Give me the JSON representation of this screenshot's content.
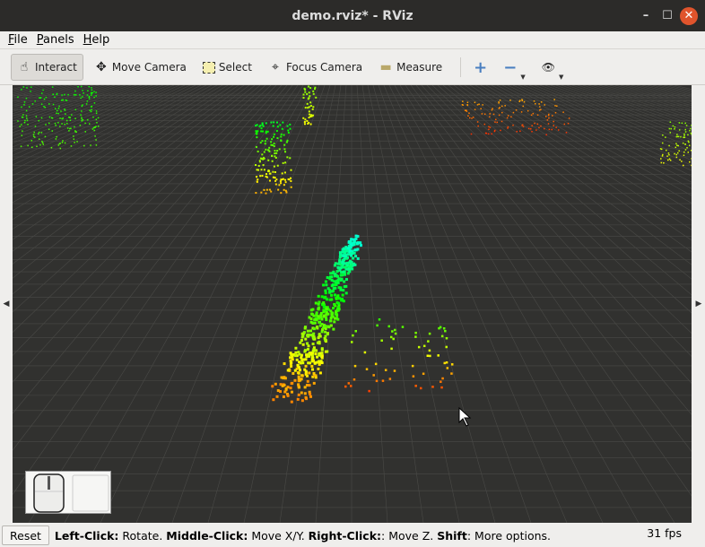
{
  "window": {
    "title": "demo.rviz* - RViz",
    "minimize": "–",
    "maximize": "☐",
    "close": "✕"
  },
  "menu": [
    {
      "label": "File",
      "key": "F",
      "rest": "ile"
    },
    {
      "label": "Panels",
      "key": "P",
      "rest": "anels"
    },
    {
      "label": "Help",
      "key": "H",
      "rest": "elp"
    }
  ],
  "toolbar": {
    "tools": [
      {
        "label": "Interact",
        "icon": "hand-icon",
        "glyph": "☝",
        "active": true
      },
      {
        "label": "Move Camera",
        "icon": "move-camera-icon",
        "glyph": "✥"
      },
      {
        "label": "Select",
        "icon": "select-icon",
        "glyph": "▢"
      },
      {
        "label": "Focus Camera",
        "icon": "focus-camera-icon",
        "glyph": "⌖"
      },
      {
        "label": "Measure",
        "icon": "ruler-icon",
        "glyph": "▬"
      }
    ],
    "add_glyph": "+",
    "remove_glyph": "−",
    "view_glyph": "👁"
  },
  "colors": {
    "viewport_bg": "#31312f",
    "grid": "#4a4a47",
    "titlebar": "#2c2b29",
    "close": "#e0542c"
  },
  "status": {
    "reset": "Reset",
    "segments": [
      {
        "text": "Left-Click:",
        "bold": true
      },
      {
        "text": " Rotate. ",
        "bold": false
      },
      {
        "text": "Middle-Click:",
        "bold": true
      },
      {
        "text": " Move X/Y. ",
        "bold": false
      },
      {
        "text": "Right-Click:",
        "bold": true
      },
      {
        "text": ": Move Z. ",
        "bold": false
      },
      {
        "text": "Shift",
        "bold": true
      },
      {
        "text": ": More options.",
        "bold": false
      }
    ],
    "fps": "31 fps"
  }
}
